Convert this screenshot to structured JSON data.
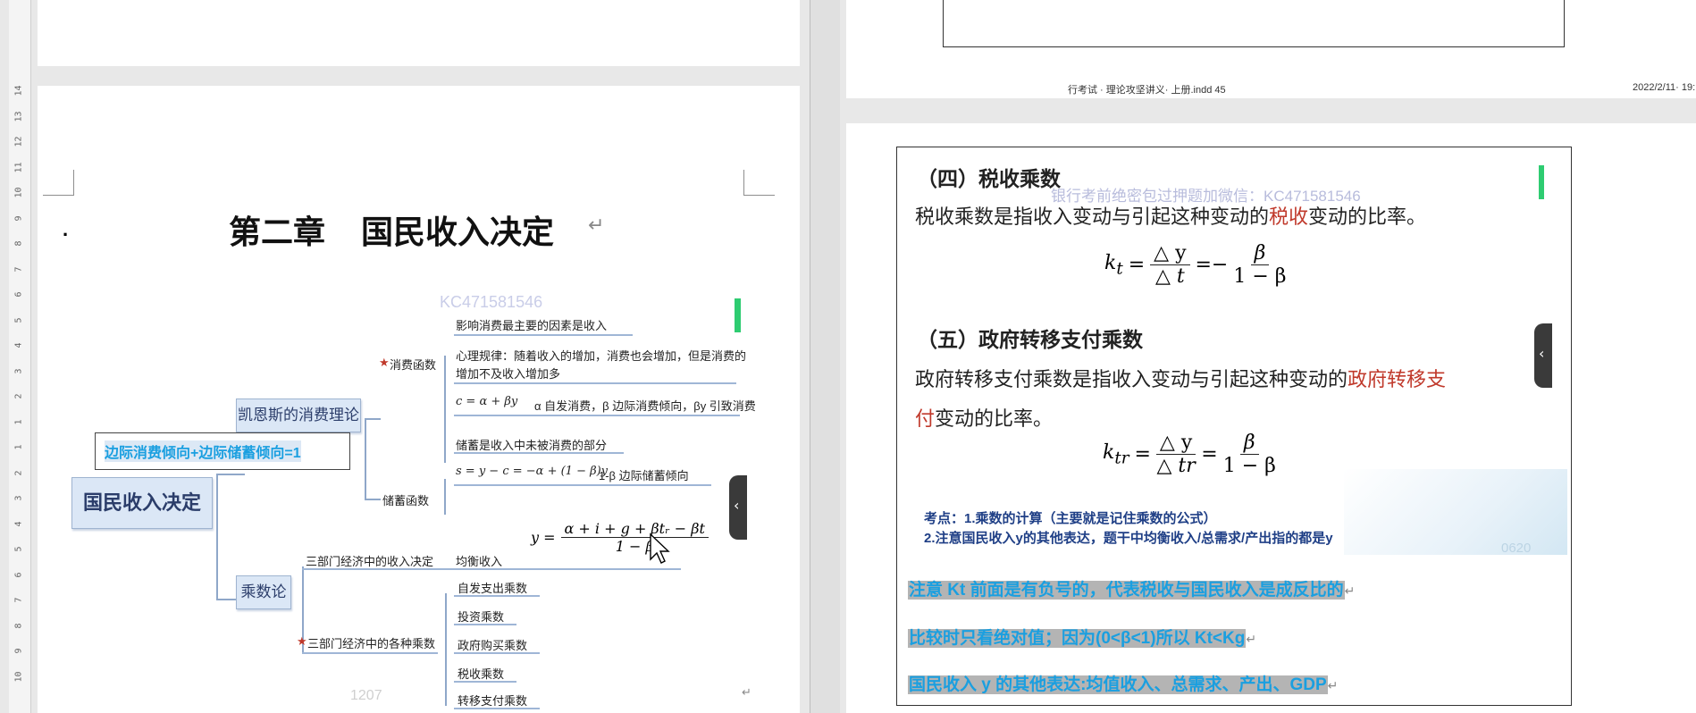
{
  "left": {
    "ruler": [
      "14",
      "13",
      "12",
      "11",
      "10",
      "9",
      "8",
      "7",
      "6",
      "5",
      "4",
      "3",
      "2",
      "1",
      "1",
      "2",
      "3",
      "4",
      "5",
      "6",
      "7",
      "8",
      "9",
      "10"
    ],
    "chapter_title": "第二章    国民收入决定",
    "bullet": ".",
    "watermark": "KC471581546",
    "note_box": "边际消费倾向+边际储蓄倾向=1",
    "mindmap": {
      "root": "国民收入决定",
      "keynes": "凯恩斯的消费理论",
      "multiplier": "乘数论",
      "consumption_fn": "消费函数",
      "saving_fn": "储蓄函数",
      "c_items": [
        "影响消费最主要的因素是收入",
        "心理规律：随着收入的增加，消费也会增加，但是消费的",
        "增加不及收入增加多"
      ],
      "c_formula": "c = α + βy",
      "c_formula_note": "α 自发消费，β 边际消费倾向，βy 引致消费",
      "s_item": "储蓄是收入中未被消费的部分",
      "s_formula": "s = y − c = −α + (1 − β)y",
      "s_formula_note": "1-β 边际储蓄倾向",
      "three_sector_income": "三部门经济中的收入决定",
      "equilibrium": "均衡收入",
      "eq_formula_lhs": "y =",
      "eq_formula_num": "α + i + g + βtᵣ − βt",
      "eq_formula_den": "1 − β",
      "three_sector_mult": "三部门经济中的各种乘数",
      "mult_items": [
        "自发支出乘数",
        "投资乘数",
        "政府购买乘数",
        "税收乘数",
        "转移支付乘数"
      ],
      "faint_number": "1207"
    }
  },
  "right": {
    "footer_left": "行考试 · 理论攻坚讲义· 上册.indd  45",
    "footer_right": "2022/2/11· 19:",
    "tax_heading": "（四）税收乘数",
    "watermark": "银行考前绝密包过押题加微信：KC471581546",
    "tax_def_1": "税收乘数是指收入变动与引起这种变动的",
    "tax_def_red": "税收",
    "tax_def_2": "变动的比率。",
    "kt_lhs": "k",
    "kt_sub": "t",
    "kt_num": "△ y",
    "kt_den": "△ t",
    "kt_mid": "=−",
    "kt_rnum": "β",
    "kt_rden": "1 − β",
    "transfer_heading": "（五）政府转移支付乘数",
    "transfer_def_1": "政府转移支付乘数是指收入变动与引起这种变动的",
    "transfer_def_red1": "政府转移支",
    "transfer_def_red2": "付",
    "transfer_def_2": "变动的比率。",
    "ktr_lhs": "k",
    "ktr_sub": "tr",
    "ktr_num": "△ y",
    "ktr_den": "△ tr",
    "ktr_rnum": "β",
    "ktr_rden": "1 − β",
    "point_1": "考点：1.乘数的计算（主要就是记住乘数的公式）",
    "point_2": "2.注意国民收入y的其他表达，题干中均衡收入/总需求/产出指的都是y",
    "faint_number": "0620",
    "note_1": "注意 Kt 前面是有负号的，代表税收与国民收入是成反比的",
    "note_2": "比较时只看绝对值；因为(0<β<1)所以 Kt<Kg",
    "note_3": "国民收入 y 的其他表达:均值收入、总需求、产出、GDP"
  },
  "colors": {
    "accent_blue": "#1a9fe0",
    "red_text": "#c0392b",
    "node_fill": "#dbe7f6"
  }
}
